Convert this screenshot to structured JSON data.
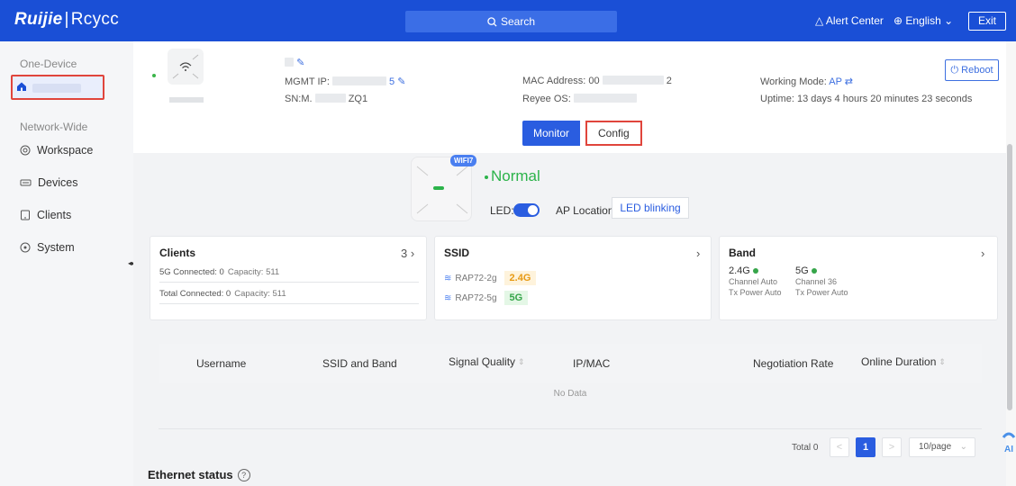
{
  "topbar": {
    "logo_brand": "Ruijie",
    "logo_sep": "|",
    "logo_product": "Rcycc",
    "search_label": "Search",
    "alert_label": "Alert Center",
    "language_label": "English",
    "exit_label": "Exit"
  },
  "sidebar": {
    "one_device_label": "One-Device",
    "network_wide_label": "Network-Wide",
    "items": [
      {
        "label": "Workspace",
        "icon": "workspace-icon"
      },
      {
        "label": "Devices",
        "icon": "devices-icon"
      },
      {
        "label": "Clients",
        "icon": "clients-icon"
      },
      {
        "label": "System",
        "icon": "system-icon"
      }
    ]
  },
  "device": {
    "mgmt_ip_label": "MGMT IP:",
    "mgmt_ip_tail": "5",
    "sn_label": "SN:M.",
    "sn_tail": "ZQ1",
    "mac_label": "MAC Address: 00",
    "mac_tail": "2",
    "os_label": "Reyee OS:",
    "working_mode_label": "Working Mode:",
    "working_mode_value": "AP",
    "uptime": "Uptime: 13 days 4 hours 20 minutes 23 seconds",
    "reboot_label": "Reboot"
  },
  "tabs": {
    "monitor": "Monitor",
    "config": "Config"
  },
  "status": {
    "wifi_badge": "WIFI7",
    "state": "Normal",
    "led_label": "LED:",
    "led_on": true,
    "ap_location_label": "AP Location:",
    "ap_location_value": "LED blinking"
  },
  "cards": {
    "clients": {
      "title": "Clients",
      "count": "3",
      "row1_a": "5G Connected: 0",
      "row1_b": "Capacity: 511",
      "row2_a": "Total Connected: 0",
      "row2_b": "Capacity: 511"
    },
    "ssid": {
      "title": "SSID",
      "items": [
        {
          "name": "RAP72-2g",
          "band": "2.4G"
        },
        {
          "name": "RAP72-5g",
          "band": "5G"
        }
      ]
    },
    "band": {
      "title": "Band",
      "b24": {
        "name": "2.4G",
        "channel": "Channel Auto",
        "power": "Tx Power Auto"
      },
      "b5": {
        "name": "5G",
        "channel": "Channel 36",
        "power": "Tx Power Auto"
      }
    }
  },
  "table": {
    "columns": [
      "Username",
      "SSID and Band",
      "Signal Quality",
      "IP/MAC",
      "Negotiation Rate",
      "Online Duration"
    ],
    "empty_text": "No Data"
  },
  "pagination": {
    "total_label": "Total 0",
    "current_page": "1",
    "prev": "<",
    "next": ">",
    "page_size": "10/page"
  },
  "ethernet": {
    "title": "Ethernet status",
    "help": "?"
  },
  "colors": {
    "brand_blue": "#1a4fd6",
    "accent": "#2a5de0",
    "success": "#2cb34a",
    "highlight_border": "#e0453c"
  }
}
